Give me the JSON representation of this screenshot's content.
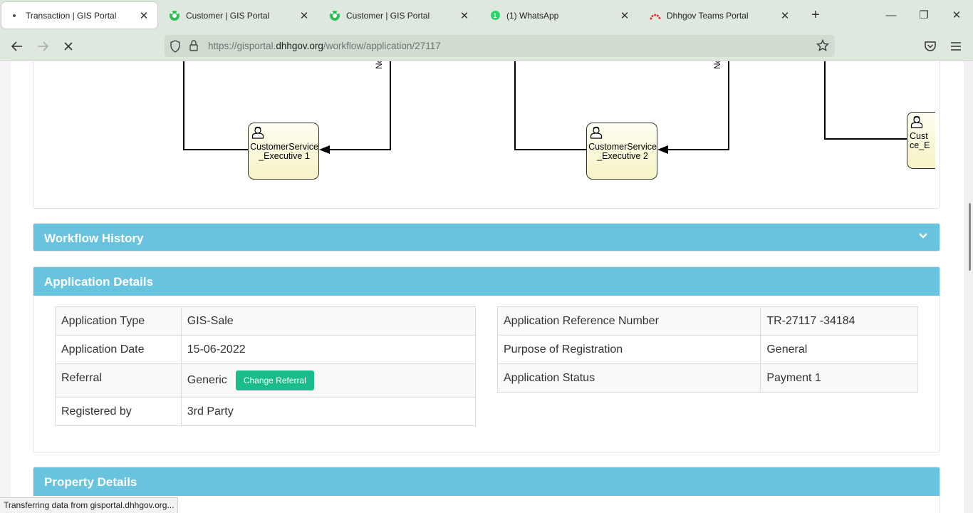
{
  "browser": {
    "tabs": [
      {
        "title": "Transaction | GIS Portal",
        "active": true,
        "icon": "loading-dot-icon"
      },
      {
        "title": "Customer | GIS Portal",
        "active": false,
        "icon": "gis-portal-icon"
      },
      {
        "title": "Customer | GIS Portal",
        "active": false,
        "icon": "gis-portal-icon"
      },
      {
        "title": "(1) WhatsApp",
        "active": false,
        "icon": "whatsapp-icon",
        "badge": "1"
      },
      {
        "title": "Dhhgov Teams Portal",
        "active": false,
        "icon": "teams-portal-icon"
      }
    ],
    "url": {
      "prefix": "https://gisportal.",
      "host": "dhhgov.org",
      "path": "/workflow/application/27117"
    },
    "status_text": "Transferring data from gisportal.dhhgov.org..."
  },
  "diagram": {
    "nodes": [
      {
        "label": "CustomerService_Executive 1"
      },
      {
        "label": "CustomerService_Executive 2"
      },
      {
        "label": "Cust..."
      }
    ],
    "edge_label": "No",
    "partial_label_line1": "Cust",
    "partial_label_line2": "ce_E"
  },
  "workflow_history": {
    "title": "Workflow History"
  },
  "application_details": {
    "title": "Application Details",
    "left": [
      {
        "label": "Application Type",
        "value": "GIS-Sale"
      },
      {
        "label": "Application Date",
        "value": "15-06-2022"
      },
      {
        "label": "Referral",
        "value": "Generic",
        "button": "Change Referral"
      },
      {
        "label": "Registered by",
        "value": "3rd Party"
      }
    ],
    "right": [
      {
        "label": "Application Reference Number",
        "value": "TR-27117 -34184"
      },
      {
        "label": "Purpose of Registration",
        "value": "General"
      },
      {
        "label": "Application Status",
        "value": "Payment 1"
      }
    ]
  },
  "property_details": {
    "title": "Property Details"
  },
  "colors": {
    "panel_header": "#68c3df",
    "button_green": "#1abc8c",
    "node_fill": "#f6f3c6"
  }
}
